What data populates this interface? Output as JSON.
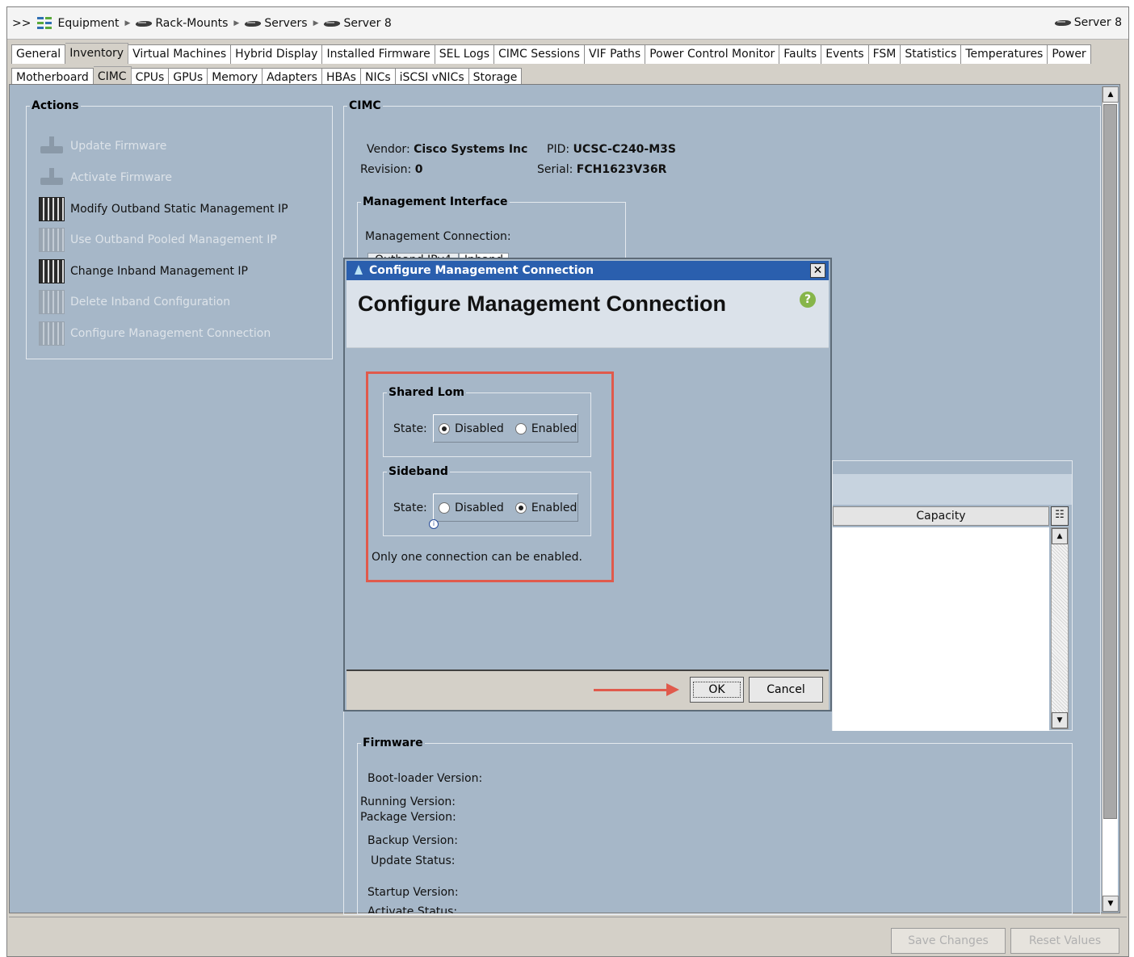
{
  "breadcrumb": {
    "prefix": ">>",
    "items": [
      "Equipment",
      "Rack-Mounts",
      "Servers",
      "Server 8"
    ],
    "right_label": "Server 8"
  },
  "tabs_primary": [
    "General",
    "Inventory",
    "Virtual Machines",
    "Hybrid Display",
    "Installed Firmware",
    "SEL Logs",
    "CIMC Sessions",
    "VIF Paths",
    "Power Control Monitor",
    "Faults",
    "Events",
    "FSM",
    "Statistics",
    "Temperatures",
    "Power"
  ],
  "tabs_primary_active": "Inventory",
  "tabs_secondary": [
    "Motherboard",
    "CIMC",
    "CPUs",
    "GPUs",
    "Memory",
    "Adapters",
    "HBAs",
    "NICs",
    "iSCSI vNICs",
    "Storage"
  ],
  "tabs_secondary_active": "CIMC",
  "actions": {
    "title": "Actions",
    "items": [
      {
        "label": "Update Firmware",
        "enabled": false,
        "icon": "firmware-icon"
      },
      {
        "label": "Activate Firmware",
        "enabled": false,
        "icon": "firmware-icon"
      },
      {
        "label": "Modify Outband Static Management IP",
        "enabled": true,
        "icon": "switch-icon"
      },
      {
        "label": "Use Outband Pooled Management IP",
        "enabled": false,
        "icon": "switch-icon"
      },
      {
        "label": "Change Inband Management IP",
        "enabled": true,
        "icon": "switch-icon"
      },
      {
        "label": "Delete Inband Configuration",
        "enabled": false,
        "icon": "switch-icon"
      },
      {
        "label": "Configure Management Connection",
        "enabled": false,
        "icon": "switch-icon"
      }
    ]
  },
  "cimc": {
    "title": "CIMC",
    "vendor_label": "Vendor:",
    "vendor": "Cisco Systems Inc",
    "pid_label": "PID:",
    "pid": "UCSC-C240-M3S",
    "revision_label": "Revision:",
    "revision": "0",
    "serial_label": "Serial:",
    "serial": "FCH1623V36R"
  },
  "mgmt_interface": {
    "title": "Management Interface",
    "connection_label": "Management Connection:",
    "tab1": "Outband IPv4",
    "tab2": "Inband"
  },
  "table": {
    "column": "Capacity"
  },
  "firmware": {
    "title": "Firmware",
    "boot_loader": "Boot-loader Version:",
    "running": "Running Version:",
    "package": "Package Version:",
    "backup": "Backup Version:",
    "update_status": "Update Status:",
    "startup": "Startup Version:",
    "activate_status": "Activate Status:"
  },
  "dialog": {
    "window_title": "Configure Management Connection",
    "heading": "Configure Management Connection",
    "shared_lom": {
      "title": "Shared Lom",
      "state_label": "State:",
      "options": [
        "Disabled",
        "Enabled"
      ],
      "selected": "Disabled"
    },
    "sideband": {
      "title": "Sideband",
      "state_label": "State:",
      "options": [
        "Disabled",
        "Enabled"
      ],
      "selected": "Enabled"
    },
    "note": "Only one connection can be enabled.",
    "ok": "OK",
    "cancel": "Cancel",
    "highlight_color": "#e05a4c"
  },
  "footer": {
    "save": "Save Changes",
    "reset": "Reset Values"
  },
  "colors": {
    "pane_bg": "#a6b7c8",
    "title_bar": "#2a5fae",
    "annotation": "#e05a4c"
  }
}
